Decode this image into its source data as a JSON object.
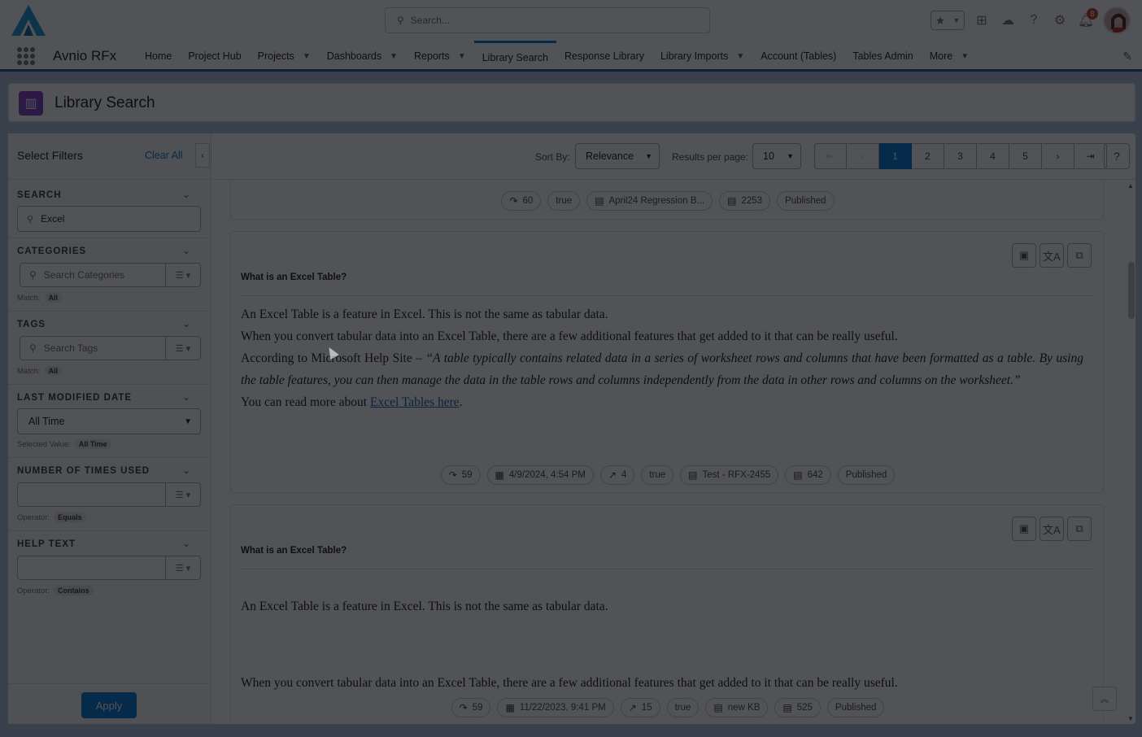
{
  "global": {
    "search_placeholder": "Search...",
    "notification_count": "8"
  },
  "nav": {
    "app_name": "Avnio RFx",
    "items": [
      {
        "label": "Home",
        "chevron": false
      },
      {
        "label": "Project Hub",
        "chevron": false
      },
      {
        "label": "Projects",
        "chevron": true
      },
      {
        "label": "Dashboards",
        "chevron": true
      },
      {
        "label": "Reports",
        "chevron": true
      },
      {
        "label": "Library Search",
        "chevron": false,
        "active": true
      },
      {
        "label": "Response Library",
        "chevron": false
      },
      {
        "label": "Library Imports",
        "chevron": true
      },
      {
        "label": "Account (Tables)",
        "chevron": false
      },
      {
        "label": "Tables Admin",
        "chevron": false
      },
      {
        "label": "More",
        "chevron": true
      }
    ]
  },
  "page": {
    "title": "Library Search"
  },
  "filters": {
    "title": "Select Filters",
    "clear_all": "Clear All",
    "search": {
      "label": "SEARCH",
      "value": "Excel"
    },
    "categories": {
      "label": "CATEGORIES",
      "placeholder": "Search Categories",
      "match_label": "Match:",
      "match_value": "All"
    },
    "tags": {
      "label": "TAGS",
      "placeholder": "Search Tags",
      "match_label": "Match:",
      "match_value": "All"
    },
    "last_modified": {
      "label": "LAST MODIFIED DATE",
      "value": "All Time",
      "selected_label": "Selected Value:",
      "selected_value": "All Time"
    },
    "times_used": {
      "label": "NUMBER OF TIMES USED",
      "operator_label": "Operator:",
      "operator_value": "Equals"
    },
    "help_text": {
      "label": "HELP TEXT",
      "operator_label": "Operator:",
      "operator_value": "Contains"
    },
    "apply": "Apply"
  },
  "toolbar": {
    "sort_label": "Sort By:",
    "sort_value": "Relevance",
    "rpp_label": "Results per page:",
    "rpp_value": "10",
    "pages": [
      "1",
      "2",
      "3",
      "4",
      "5"
    ],
    "current_page": "1",
    "help": "?"
  },
  "results": {
    "top_chips": [
      {
        "icon": "views-icon",
        "glyph": "↷",
        "text": "60"
      },
      {
        "icon": "",
        "glyph": "",
        "text": "true"
      },
      {
        "icon": "library-icon",
        "glyph": "▤",
        "text": "April24 Regression B..."
      },
      {
        "icon": "id-icon",
        "glyph": "▤",
        "text": "2253"
      },
      {
        "icon": "",
        "glyph": "",
        "text": "Published"
      }
    ],
    "cards": [
      {
        "question": "What is an Excel Table?",
        "lines": {
          "l1": "An Excel Table is a feature in Excel. This is not the same as tabular data.",
          "l2": "When you convert tabular data into an Excel Table, there are a few additional features that get added to it that can be really useful.",
          "l3a": "According to Microsoft Help Site – ",
          "l3b": "“A table typically contains related data in a series of worksheet rows and columns that have been formatted as a table. By using the table features, you can then manage the data in the table rows and columns independently from the data in other rows and columns on the worksheet.”",
          "l4a": "You can read more about ",
          "l4link": "Excel Tables here",
          "l4b": "."
        },
        "chips": [
          {
            "icon": "views-icon",
            "glyph": "↷",
            "text": "59"
          },
          {
            "icon": "calendar-icon",
            "glyph": "▦",
            "text": "4/9/2024, 4:54 PM"
          },
          {
            "icon": "trend-icon",
            "glyph": "↗",
            "text": "4"
          },
          {
            "icon": "",
            "glyph": "",
            "text": "true"
          },
          {
            "icon": "library-icon",
            "glyph": "▤",
            "text": "Test - RFX-2455"
          },
          {
            "icon": "id-icon",
            "glyph": "▤",
            "text": "642"
          },
          {
            "icon": "",
            "glyph": "",
            "text": "Published"
          }
        ]
      },
      {
        "question": "What is an Excel Table?",
        "lines": {
          "l1": "An Excel Table is a feature in Excel. This is not the same as tabular data.",
          "l2": "When you convert tabular data into an Excel Table, there are a few additional features that get added to it that can be really useful."
        },
        "chips": [
          {
            "icon": "views-icon",
            "glyph": "↷",
            "text": "59"
          },
          {
            "icon": "calendar-icon",
            "glyph": "▦",
            "text": "11/22/2023, 9:41 PM"
          },
          {
            "icon": "trend-icon",
            "glyph": "↗",
            "text": "15"
          },
          {
            "icon": "",
            "glyph": "",
            "text": "true"
          },
          {
            "icon": "library-icon",
            "glyph": "▤",
            "text": "new KB"
          },
          {
            "icon": "id-icon",
            "glyph": "▤",
            "text": "525"
          },
          {
            "icon": "",
            "glyph": "",
            "text": "Published"
          }
        ]
      }
    ]
  },
  "colors": {
    "brand": "#0176d3",
    "overlay": "#080a0e",
    "app_icon": "#7f3ec8"
  }
}
